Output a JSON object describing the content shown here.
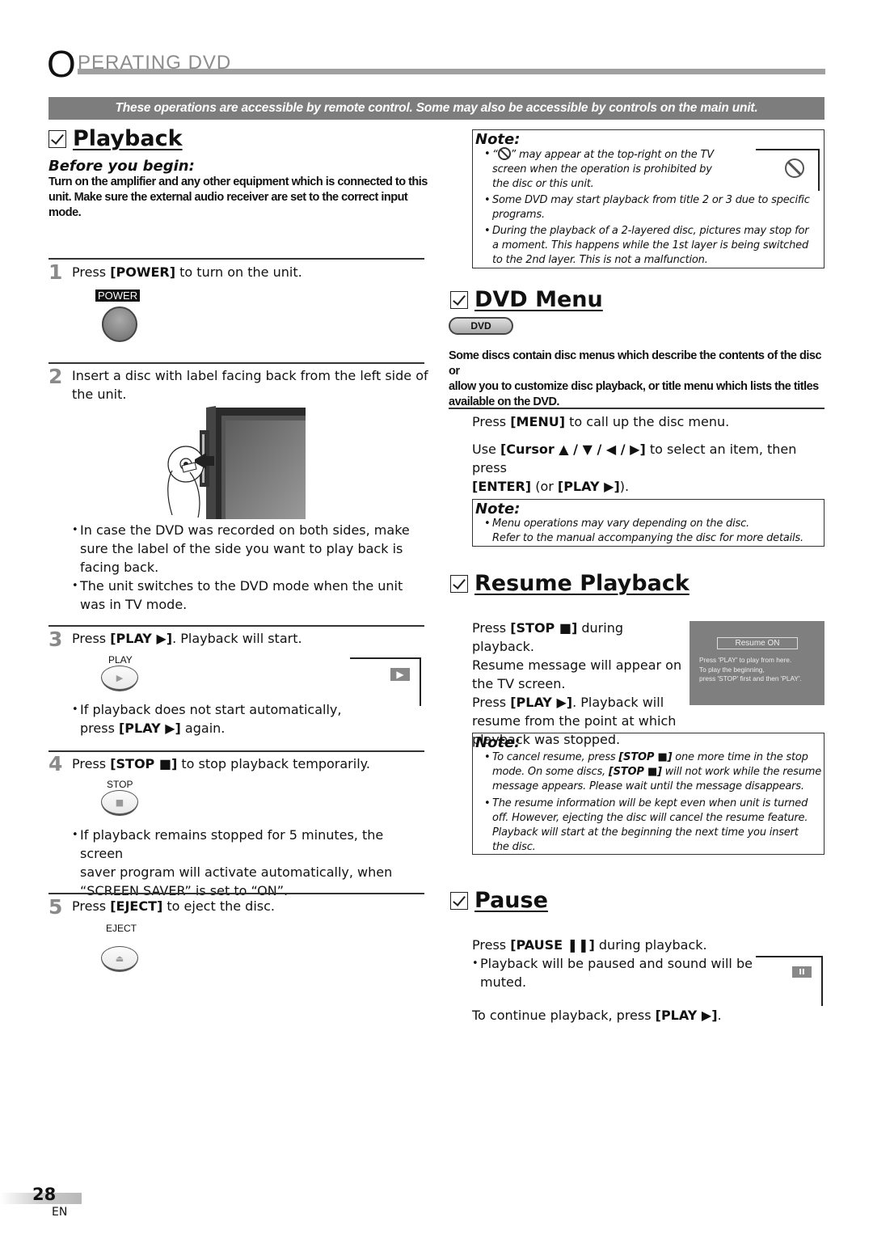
{
  "header": {
    "title_first_letter": "O",
    "title_rest": "PERATING   DVD",
    "banner": "These operations are accessible by remote control.  Some may also be accessible by controls on the main unit."
  },
  "playback": {
    "title": "Playback",
    "before_heading": "Before you begin:",
    "before_text": [
      "Turn on the amplifier and any other equipment which is connected to this",
      "unit. Make sure the external audio receiver are set to the correct input",
      "mode."
    ],
    "steps": [
      {
        "num": "1",
        "pre": "Press ",
        "key": "[POWER]",
        "post": " to turn on the unit.",
        "button_label": "POWER",
        "button_icon": "power-button"
      },
      {
        "num": "2",
        "text_lines": [
          "Insert a disc with label facing back from the left side of",
          "the unit."
        ],
        "illustration": "disc-insert-illustration",
        "bullets": [
          [
            "In case the DVD was recorded on both sides, make",
            "sure the label of the side you want to play back is",
            "facing back."
          ],
          [
            "The unit switches to the DVD mode when the unit",
            "was in TV mode."
          ]
        ]
      },
      {
        "num": "3",
        "pre": "Press ",
        "key": "[PLAY ▶]",
        "post": ". Playback will start.",
        "button_label": "PLAY",
        "button_glyph": "▶",
        "osd_glyph": "▶",
        "bullets": [
          {
            "line1": "If playback does not start automatically,",
            "line2_pre": "press ",
            "line2_key": "[PLAY ▶]",
            "line2_post": " again."
          }
        ]
      },
      {
        "num": "4",
        "pre": "Press ",
        "key": "[STOP ■]",
        "post": " to stop playback temporarily.",
        "button_label": "STOP",
        "button_glyph": "■",
        "bullets": [
          [
            "If playback remains stopped for 5 minutes, the screen",
            "saver program will activate automatically, when",
            "“SCREEN SAVER” is set to “ON”."
          ]
        ]
      },
      {
        "num": "5",
        "pre": "Press ",
        "key": "[EJECT]",
        "post": " to eject the disc.",
        "button_label": "EJECT",
        "button_glyph": "⏏"
      }
    ]
  },
  "note1": {
    "heading": "Note:",
    "items": [
      [
        "“⃀” may appear at the top-right on the TV",
        "screen when the operation is prohibited by",
        "the disc or this unit."
      ],
      [
        "Some DVD may start playback from title 2 or 3 due to specific",
        "programs."
      ],
      [
        "During the playback of a 2-layered disc, pictures may stop for",
        "a moment. This happens while the 1st layer is being switched",
        "to the 2nd layer. This is not a malfunction."
      ]
    ],
    "item1_prefix": "“",
    "item1_line1_rest": "” may appear at the top-right on the TV"
  },
  "dvd_menu": {
    "title": "DVD Menu",
    "pill_label": "DVD",
    "description": [
      "Some discs contain disc menus which describe the contents of the disc or",
      "allow you to customize disc playback, or title menu which lists the titles",
      "available on the DVD."
    ],
    "step1": {
      "pre": "Press ",
      "key": "[MENU]",
      "post": " to call up the disc menu."
    },
    "step2": {
      "pre": "Use ",
      "key": "[Cursor ▲ / ▼ / ◀ / ▶]",
      "post": " to select an item, then press",
      "line2_key1": "[ENTER]",
      "line2_mid": " (or ",
      "line2_key2": "[PLAY ▶]",
      "line2_post": ")."
    }
  },
  "note2": {
    "heading": "Note:",
    "lines": [
      "Menu operations may vary depending on the disc.",
      "Refer to the manual accompanying the disc for more details."
    ]
  },
  "resume": {
    "title": "Resume Playback",
    "l1_pre": "Press ",
    "l1_key": "[STOP ■]",
    "l1_post": " during playback.",
    "l2": "Resume message will appear on",
    "l3": "the TV screen.",
    "l4_pre": "Press ",
    "l4_key": "[PLAY ▶]",
    "l4_post": ". Playback will",
    "l5": "resume from the point at which",
    "l6": "playback was stopped.",
    "osd": {
      "box": "Resume ON",
      "lines": [
        "Press 'PLAY' to play from here.",
        "To play the beginning,",
        "press 'STOP' first and then 'PLAY'."
      ]
    }
  },
  "note3": {
    "heading": "Note:",
    "item1": {
      "l1_pre": "To cancel resume, press ",
      "l1_key": "[STOP ■]",
      "l1_post": " one more time in the stop",
      "l2_pre": "mode. On some discs, ",
      "l2_key": "[STOP ■]",
      "l2_post": " will not work while the resume",
      "l3": "message appears. Please wait until the message disappears."
    },
    "item2": [
      "The resume information will be kept even when unit is turned",
      "off. However, ejecting the disc will cancel the resume feature.",
      "Playback will start at the beginning the next time you insert",
      "the disc."
    ]
  },
  "pause": {
    "title": "Pause",
    "l1_pre": "Press ",
    "l1_key": "[PAUSE ❚❚]",
    "l1_post": " during playback.",
    "bullet": [
      "Playback will be paused and sound will be",
      "muted."
    ],
    "continue_pre": "To continue playback, press ",
    "continue_key": "[PLAY ▶]",
    "continue_post": ".",
    "osd_glyph": "II"
  },
  "footer": {
    "page": "28",
    "lang": "EN"
  }
}
